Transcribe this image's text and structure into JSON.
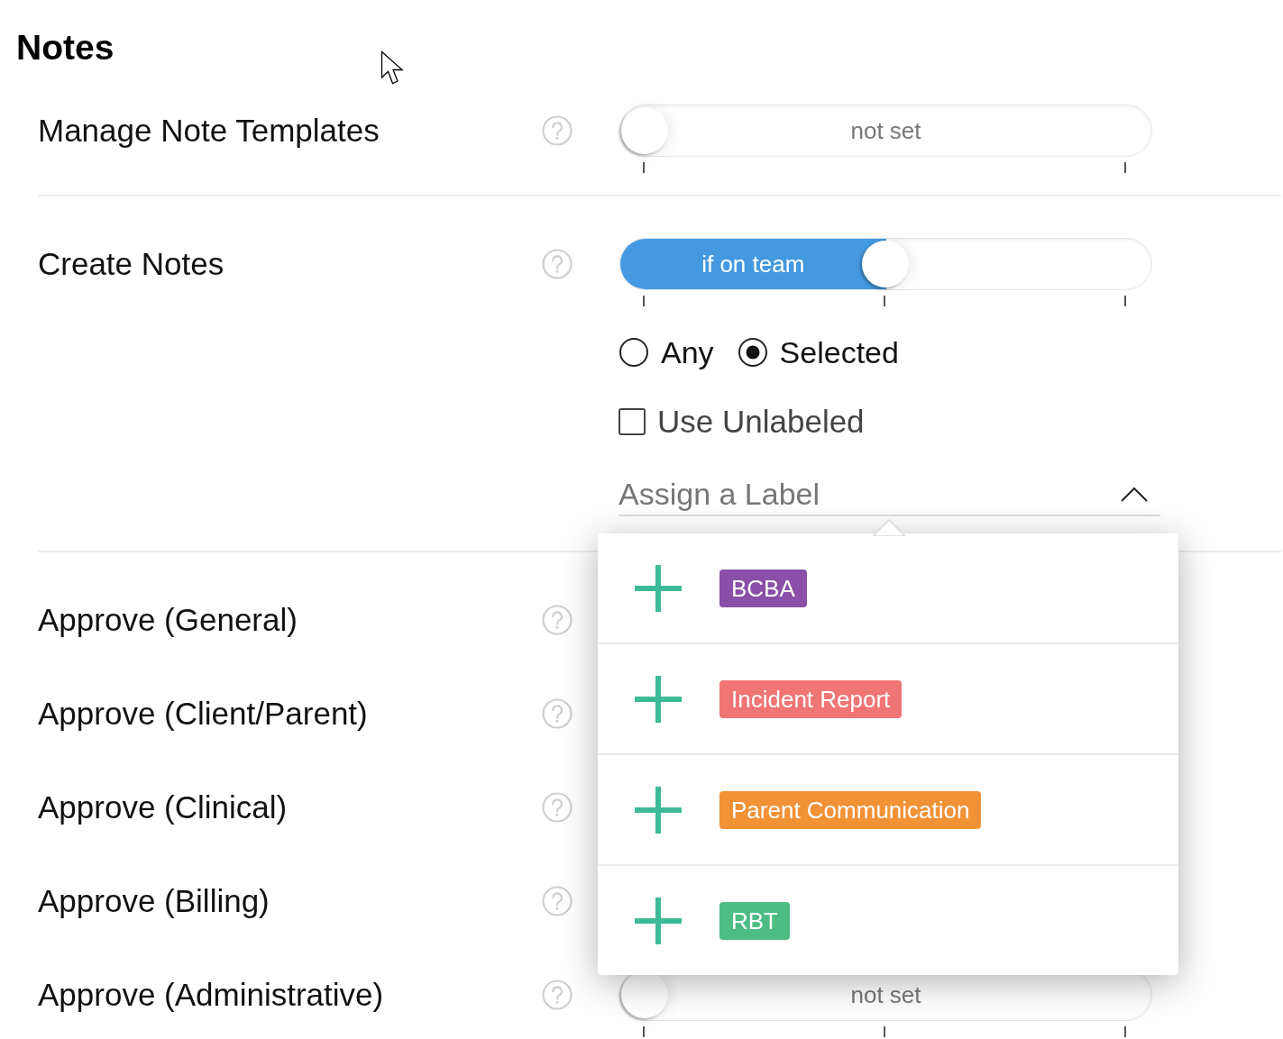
{
  "title": "Notes",
  "groups": [
    {
      "settings": [
        {
          "label": "Manage Note Templates",
          "slider": {
            "kind": "binary",
            "level": 0,
            "reading": "not set"
          }
        }
      ]
    },
    {
      "settings": [
        {
          "label": "Create Notes",
          "slider": {
            "kind": "ternary",
            "level": 0.5,
            "reading": "if on team"
          },
          "scope": [
            {
              "label": "Any",
              "selected": false
            },
            {
              "label": "Selected",
              "selected": true
            }
          ],
          "use_unlabeled": {
            "label": "Use Unlabeled",
            "checked": false
          },
          "label_select": {
            "placeholder": "Assign a Label",
            "expanded": true,
            "options": [
              {
                "label": "BCBA",
                "color": "#8a4fa8"
              },
              {
                "label": "Incident Report",
                "color": "#f07575"
              },
              {
                "label": "Parent Communication",
                "color": "#f29236"
              },
              {
                "label": "RBT",
                "color": "#4dbd84"
              }
            ]
          }
        }
      ]
    },
    {
      "settings": [
        {
          "label": "Approve (General)"
        },
        {
          "label": "Approve (Client/Parent)"
        },
        {
          "label": "Approve (Clinical)"
        },
        {
          "label": "Approve (Billing)"
        },
        {
          "label": "Approve (Administrative)",
          "slider": {
            "kind": "ternary",
            "level": 0,
            "reading": "not set"
          }
        }
      ]
    }
  ]
}
